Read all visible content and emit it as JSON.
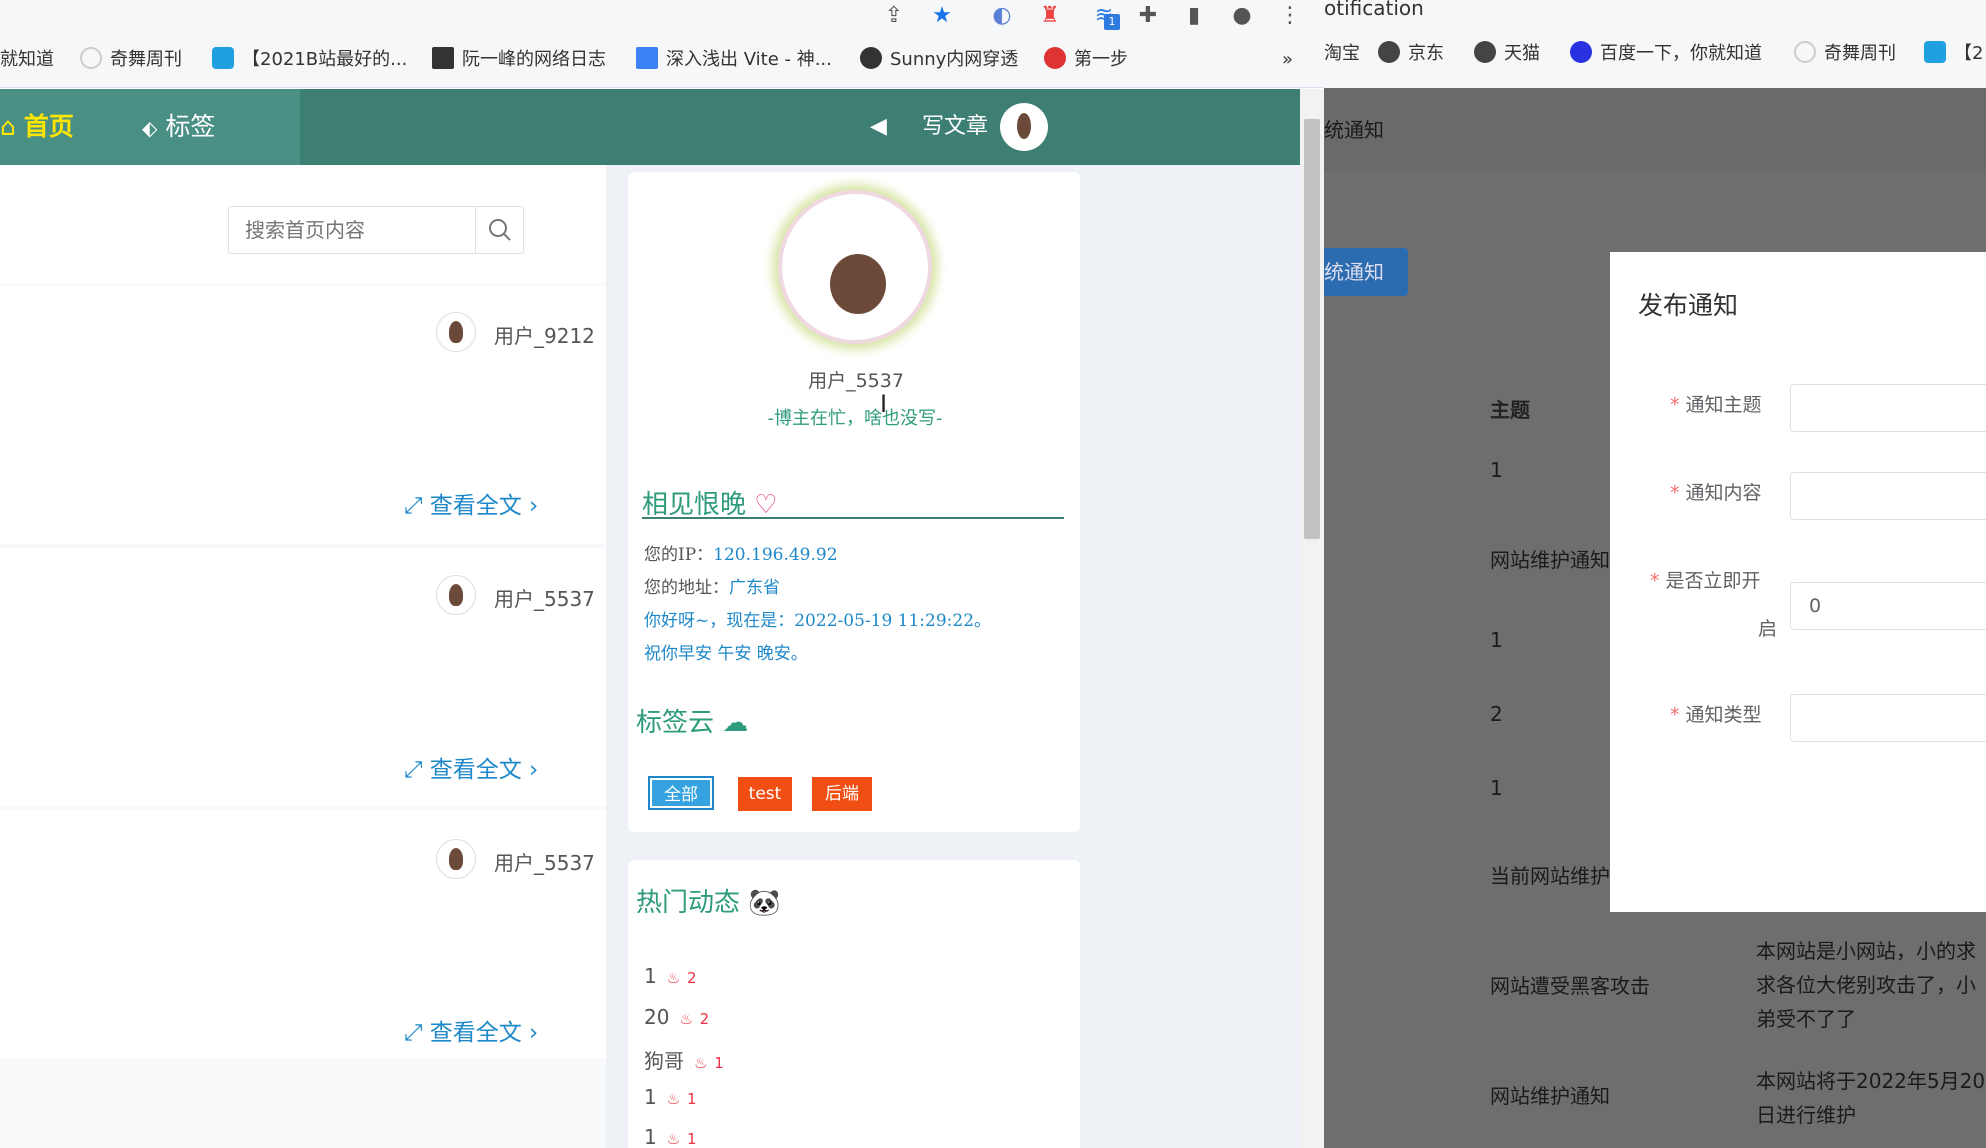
{
  "browser_left": {
    "toolbar_icons": [
      "share-icon",
      "star-icon",
      "extension-1-icon",
      "extension-2-icon",
      "extension-3-icon",
      "puzzle-icon",
      "sidepanel-icon",
      "profile-icon",
      "menu-icon"
    ],
    "extension_badge": "1",
    "bookmarks": [
      "就知道",
      "奇舞周刊",
      "【2021B站最好的...",
      "阮一峰的网络日志",
      "深入浅出 Vite - 神...",
      "Sunny内网穿透",
      "第一步"
    ],
    "bookmarks_overflow": "»"
  },
  "site": {
    "nav": {
      "home": "首页",
      "tags": "标签",
      "write": "写文章"
    },
    "search": {
      "placeholder": "搜索首页内容"
    },
    "posts": [
      {
        "user": "用户_9212",
        "readmore": "查看全文"
      },
      {
        "user": "用户_5537",
        "readmore": "查看全文"
      },
      {
        "user": "用户_5537",
        "readmore": "查看全文"
      }
    ],
    "profile": {
      "name": "用户_5537",
      "motto": "-博主在忙，啥也没写-",
      "section_title": "相见恨晚",
      "ip_label": "您的IP：",
      "ip_value": "120.196.49.92",
      "addr_label": "您的地址：",
      "addr_value": "广东省",
      "greeting": "你好呀~，现在是：2022-05-19 11:29:22。",
      "wish": "祝你早安 午安 晚安。"
    },
    "tag_cloud": {
      "title": "标签云",
      "tags": [
        "全部",
        "test",
        "后端"
      ]
    },
    "hot": {
      "title": "热门动态",
      "items": [
        {
          "name": "1",
          "count": "2"
        },
        {
          "name": "20",
          "count": "2"
        },
        {
          "name": "狗哥",
          "count": "1"
        },
        {
          "name": "1",
          "count": "1"
        },
        {
          "name": "1",
          "count": "1"
        }
      ]
    }
  },
  "browser_right": {
    "title_fragment": "otification",
    "bookmarks": [
      "淘宝",
      "京东",
      "天猫",
      "百度一下，你就知道",
      "奇舞周刊",
      "【2"
    ],
    "page_title": "统通知",
    "add_button": "统通知",
    "table": {
      "header": "主题",
      "rows": [
        "1",
        "网站维护通知",
        "1",
        "2",
        "1",
        "当前网站维护",
        "网站遭受黑客攻击",
        "网站维护通知"
      ],
      "content_1": "本网站是小网站，小的求求各位大佬别攻击了，小弟受不了了",
      "content_2": "本网站将于2022年5月20日进行维护"
    },
    "modal": {
      "title": "发布通知",
      "fields": [
        {
          "label": "通知主题",
          "value": ""
        },
        {
          "label": "通知内容",
          "value": ""
        },
        {
          "label_1": "是否立即开",
          "label_2": "启",
          "value": "0"
        },
        {
          "label": "通知类型",
          "value": ""
        }
      ]
    }
  }
}
